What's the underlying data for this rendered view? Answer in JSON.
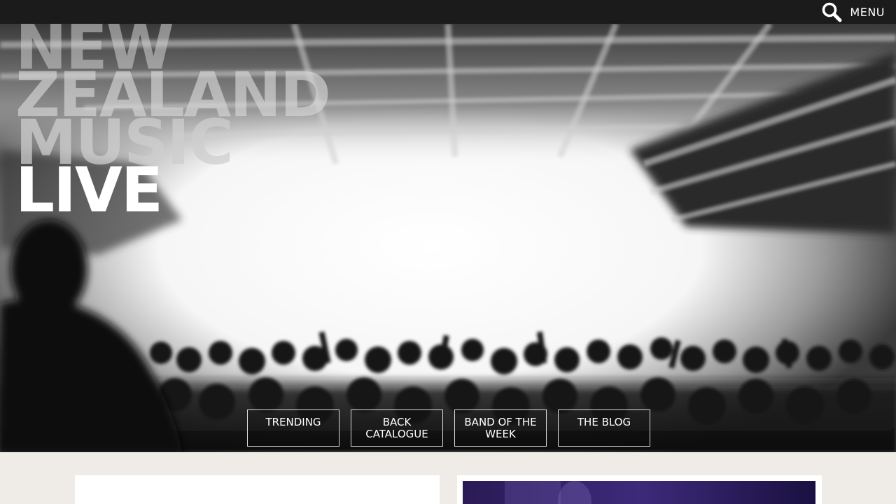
{
  "header": {
    "search_icon": "search-icon",
    "menu_label": "MENU"
  },
  "logo": {
    "line1": "NEW",
    "line2": "ZEALAND",
    "line3": "MUSIC",
    "line4": "LIVE"
  },
  "nav": {
    "items": [
      {
        "label": "TRENDING"
      },
      {
        "label": "BACK CATALOGUE"
      },
      {
        "label": "BAND OF THE WEEK"
      },
      {
        "label": "THE BLOG"
      }
    ]
  },
  "colors": {
    "topbar": "#1b1b1b",
    "page_background": "#efebe7",
    "card": "#ffffff",
    "thumb_tint": "#2a1a55"
  }
}
